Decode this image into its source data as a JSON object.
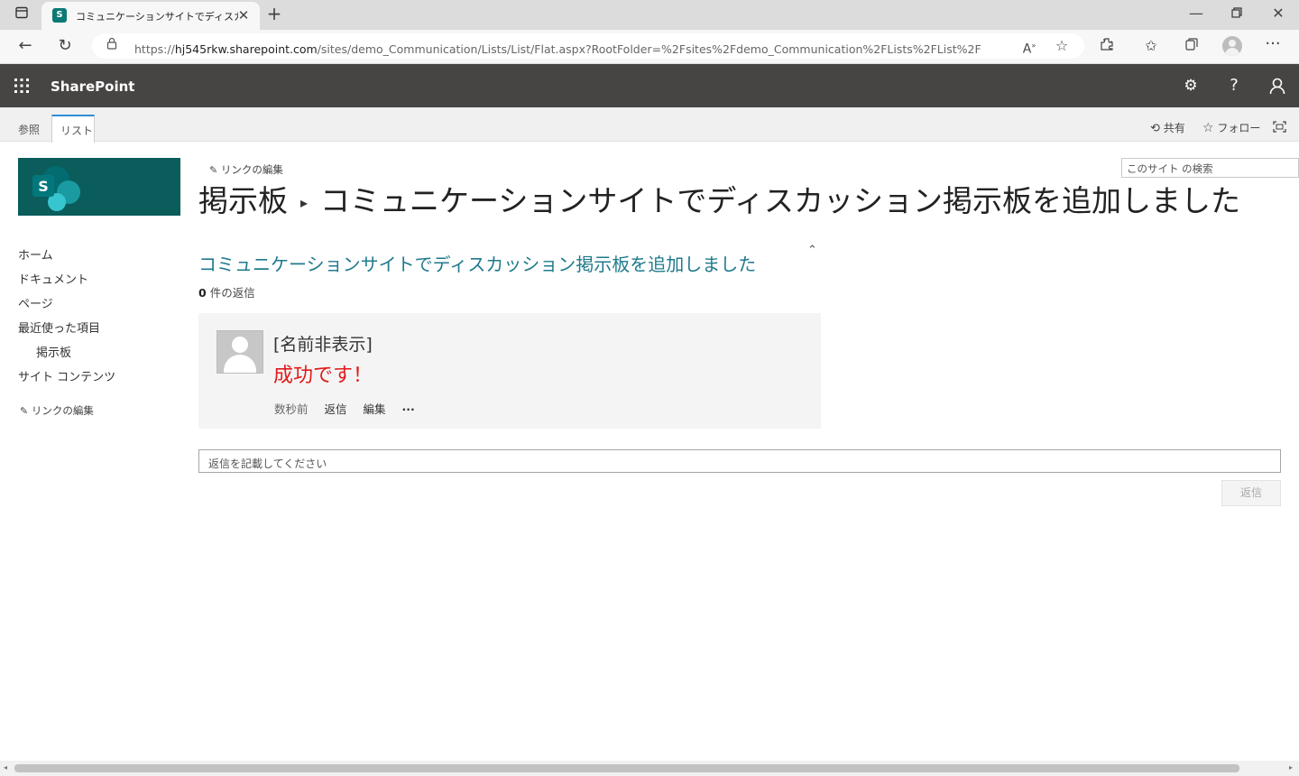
{
  "browser": {
    "tab_title": "コミュニケーションサイトでディスカッショ",
    "url_prefix": "https://",
    "url_host": "hj545rkw.sharepoint.com",
    "url_path": "/sites/demo_Communication/Lists/List/Flat.aspx?RootFolder=%2Fsites%2Fdemo_Communication%2FLists%2FList%2Fコミュニ..."
  },
  "suite": {
    "brand": "SharePoint"
  },
  "ribbon": {
    "tabs": [
      {
        "label": "参照"
      },
      {
        "label": "リスト"
      }
    ],
    "share_label": "共有",
    "follow_label": "フォロー"
  },
  "nav": {
    "edit_links_top": "リンクの編集",
    "items": [
      {
        "label": "ホーム"
      },
      {
        "label": "ドキュメント"
      },
      {
        "label": "ページ"
      },
      {
        "label": "最近使った項目"
      },
      {
        "label": "掲示板"
      },
      {
        "label": "サイト コンテンツ"
      }
    ],
    "edit_links_bottom": "リンクの編集"
  },
  "page": {
    "title_list": "掲示板",
    "title_item": "コミュニケーションサイトでディスカッション掲示板を追加しました",
    "search_placeholder": "このサイト の検索"
  },
  "thread": {
    "title": "コミュニケーションサイトでディスカッション掲示板を追加しました",
    "reply_count": "0",
    "reply_count_label": "件の返信",
    "post": {
      "author": "[名前非表示]",
      "body": "成功です！",
      "time": "数秒前",
      "reply_label": "返信",
      "edit_label": "編集",
      "more_label": "···"
    }
  },
  "reply": {
    "placeholder": "返信を記載してください",
    "button_label": "返信"
  }
}
